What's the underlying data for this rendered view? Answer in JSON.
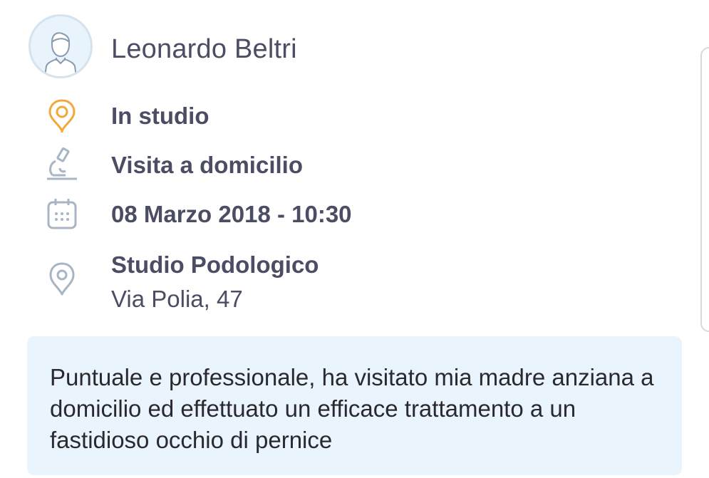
{
  "reviewer": {
    "name": "Leonardo Beltri"
  },
  "details": {
    "location_type": "In studio",
    "visit_type": "Visita a domicilio",
    "datetime": "08 Marzo 2018 - 10:30",
    "place_name": "Studio Podologico",
    "place_address": "Via Polia, 47"
  },
  "review": {
    "text": "Puntuale e professionale, ha visitato mia madre anziana a domicilio ed effettuato un efficace trattamento a un fastidioso occhio di pernice"
  },
  "icons": {
    "location_type": "pin-icon",
    "visit_type": "microscope-icon",
    "datetime": "calendar-icon",
    "place": "map-marker-icon",
    "avatar": "user-avatar-icon"
  },
  "colors": {
    "pin_accent": "#f2a93b",
    "icon_gray": "#a7b5c4",
    "text_primary": "#4a4d63",
    "review_bg": "#eaf4fd",
    "avatar_bg": "#e8f3fc"
  }
}
